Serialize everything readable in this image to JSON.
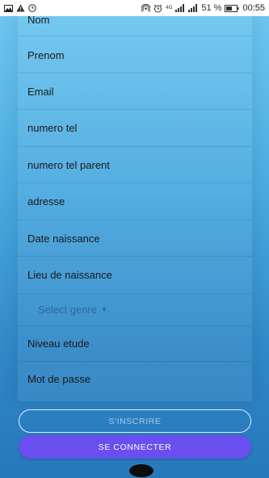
{
  "status_bar": {
    "battery_percent": "51 %",
    "time": "00:55",
    "network_label": "4G",
    "icons": [
      "image-icon",
      "warning-icon",
      "clock-icon",
      "hotspot-icon",
      "alarm-icon",
      "signal-icon",
      "battery-icon"
    ]
  },
  "form": {
    "fields": [
      "Nom",
      "Prenom",
      "Email",
      "numero tel",
      "numero tel parent",
      "adresse",
      "Date naissance",
      "Lieu de naissance"
    ],
    "genre_select": {
      "placeholder": "Select genre"
    },
    "niveau_etude": "Niveau etude",
    "mot_de_passe": "Mot de passe"
  },
  "buttons": {
    "inscrire": "S'INSCRIRE",
    "connecter": "SE CONNECTER"
  },
  "colors": {
    "background_top": "#6fc8f0",
    "background_bottom": "#2678ba",
    "primary_button": "#6a4ef0",
    "outline_button_text": "#a9cbe8"
  }
}
